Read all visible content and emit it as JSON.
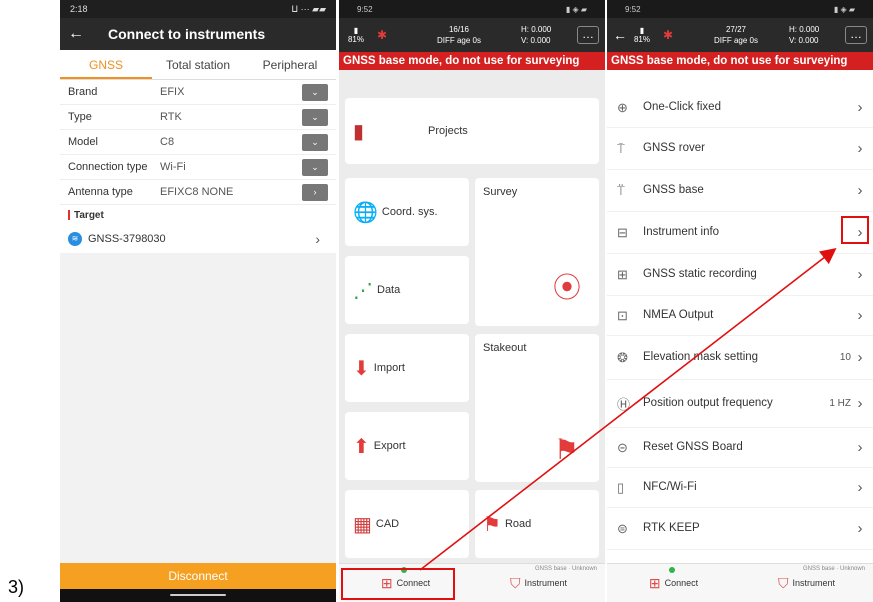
{
  "figure_label": "3)",
  "screen1": {
    "status": {
      "time": "2:18",
      "icons": "ⵡ ⋯ ▰▰"
    },
    "title": "Connect to instruments",
    "tabs": [
      {
        "label": "GNSS",
        "active": true
      },
      {
        "label": "Total station",
        "active": false
      },
      {
        "label": "Peripheral",
        "active": false
      }
    ],
    "rows": [
      {
        "label": "Brand",
        "value": "EFIX",
        "control": "dropdown"
      },
      {
        "label": "Type",
        "value": "RTK",
        "control": "dropdown"
      },
      {
        "label": "Model",
        "value": "C8",
        "control": "dropdown"
      },
      {
        "label": "Connection type",
        "value": "Wi-Fi",
        "control": "dropdown"
      },
      {
        "label": "Antenna type",
        "value": "EFIXC8 NONE",
        "control": "arrow"
      }
    ],
    "target_header": "Target",
    "device": "GNSS-3798030",
    "disconnect": "Disconnect"
  },
  "screen2": {
    "status": {
      "time": "9:52",
      "right": "▮ ◈ ▰"
    },
    "top": {
      "battery": "81%",
      "sats": "16/16",
      "mode": "DIFF age 0s",
      "h": "H: 0.000",
      "v": "V: 0.000"
    },
    "warning": "GNSS base mode, do not use for surveying",
    "tiles": {
      "projects": "Projects",
      "coord": "Coord. sys.",
      "survey": "Survey",
      "data": "Data",
      "import": "Import",
      "stakeout": "Stakeout",
      "export": "Export",
      "cad": "CAD",
      "road": "Road"
    },
    "nav": {
      "connect": "Connect",
      "instrument": "Instrument",
      "instrument_sub": "GNSS base · Unknown"
    }
  },
  "screen3": {
    "status": {
      "time": "9:52",
      "right": "▮ ◈ ▰"
    },
    "top": {
      "battery": "81%",
      "sats": "27/27",
      "mode": "DIFF age 0s",
      "h": "H: 0.000",
      "v": "V: 0.000"
    },
    "warning": "GNSS base mode, do not use for surveying",
    "menu": [
      {
        "label": "One-Click fixed",
        "value": ""
      },
      {
        "label": "GNSS rover",
        "value": ""
      },
      {
        "label": "GNSS base",
        "value": ""
      },
      {
        "label": "Instrument info",
        "value": ""
      },
      {
        "label": "GNSS static recording",
        "value": ""
      },
      {
        "label": "NMEA Output",
        "value": ""
      },
      {
        "label": "Elevation mask setting",
        "value": "10"
      },
      {
        "label": "Position output frequency",
        "value": "1 HZ"
      },
      {
        "label": "Reset GNSS Board",
        "value": ""
      },
      {
        "label": "NFC/Wi-Fi",
        "value": ""
      },
      {
        "label": "RTK KEEP",
        "value": ""
      }
    ],
    "nav": {
      "connect": "Connect",
      "instrument": "Instrument",
      "instrument_sub": "GNSS base · Unknown"
    }
  },
  "colors": {
    "accent_orange": "#f09020",
    "warning_red": "#d42020",
    "highlight_red": "#e01010"
  }
}
